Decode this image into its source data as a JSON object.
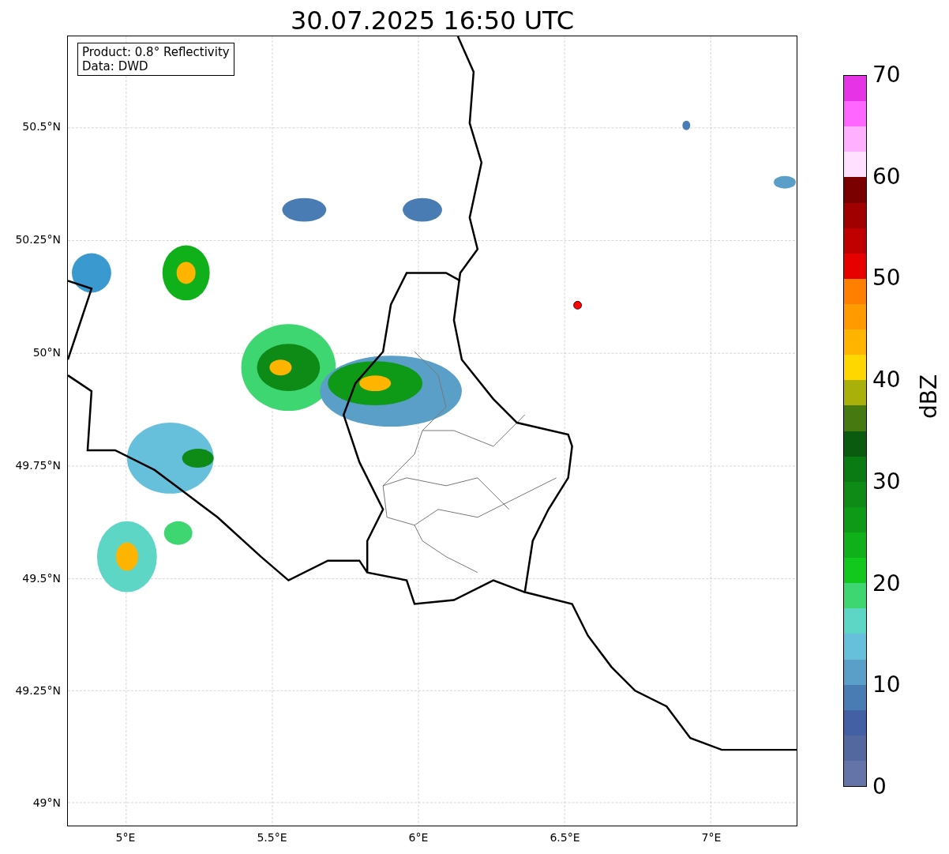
{
  "title": "30.07.2025 16:50 UTC",
  "info_box": {
    "lines": [
      "Product: 0.8° Reflectivity",
      "Data: DWD"
    ]
  },
  "map": {
    "latitude_labels": [
      "50.5°N",
      "50.25°N",
      "50°N",
      "49.75°N",
      "49.5°N",
      "49.25°N",
      "49°N"
    ],
    "longitude_labels": [
      "5°E",
      "5.5°E",
      "6°E",
      "6.5°E",
      "7°E"
    ]
  },
  "colorbar": {
    "label": "dBZ",
    "ticks": [
      "70",
      "60",
      "50",
      "40",
      "30",
      "20",
      "10",
      "0"
    ]
  }
}
